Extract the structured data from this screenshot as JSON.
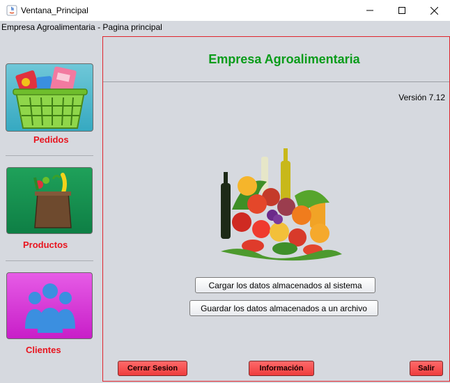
{
  "window": {
    "title": "Ventana_Principal"
  },
  "frame": {
    "label": "Empresa Agroalimentaria - Pagina principal"
  },
  "sidebar": {
    "items": [
      {
        "label": "Pedidos",
        "icon": "shopping-basket-icon"
      },
      {
        "label": "Productos",
        "icon": "grocery-bag-icon"
      },
      {
        "label": "Clientes",
        "icon": "people-icon"
      }
    ]
  },
  "main": {
    "title": "Empresa Agroalimentaria",
    "version": "Versión 7.12",
    "hero_icon": "fruits-vegetables-image",
    "buttons": {
      "cargar": "Cargar los datos almacenados al sistema",
      "guardar": "Guardar los datos almacenados a un archivo"
    },
    "footer": {
      "cerrar": "Cerrar Sesion",
      "info": "Información",
      "salir": "Salir"
    }
  },
  "colors": {
    "background": "#d6d9df",
    "title_green": "#0a9c1a",
    "label_red": "#e8141e",
    "panel_border": "#e0252d",
    "danger_button": "#ee3d3d"
  }
}
